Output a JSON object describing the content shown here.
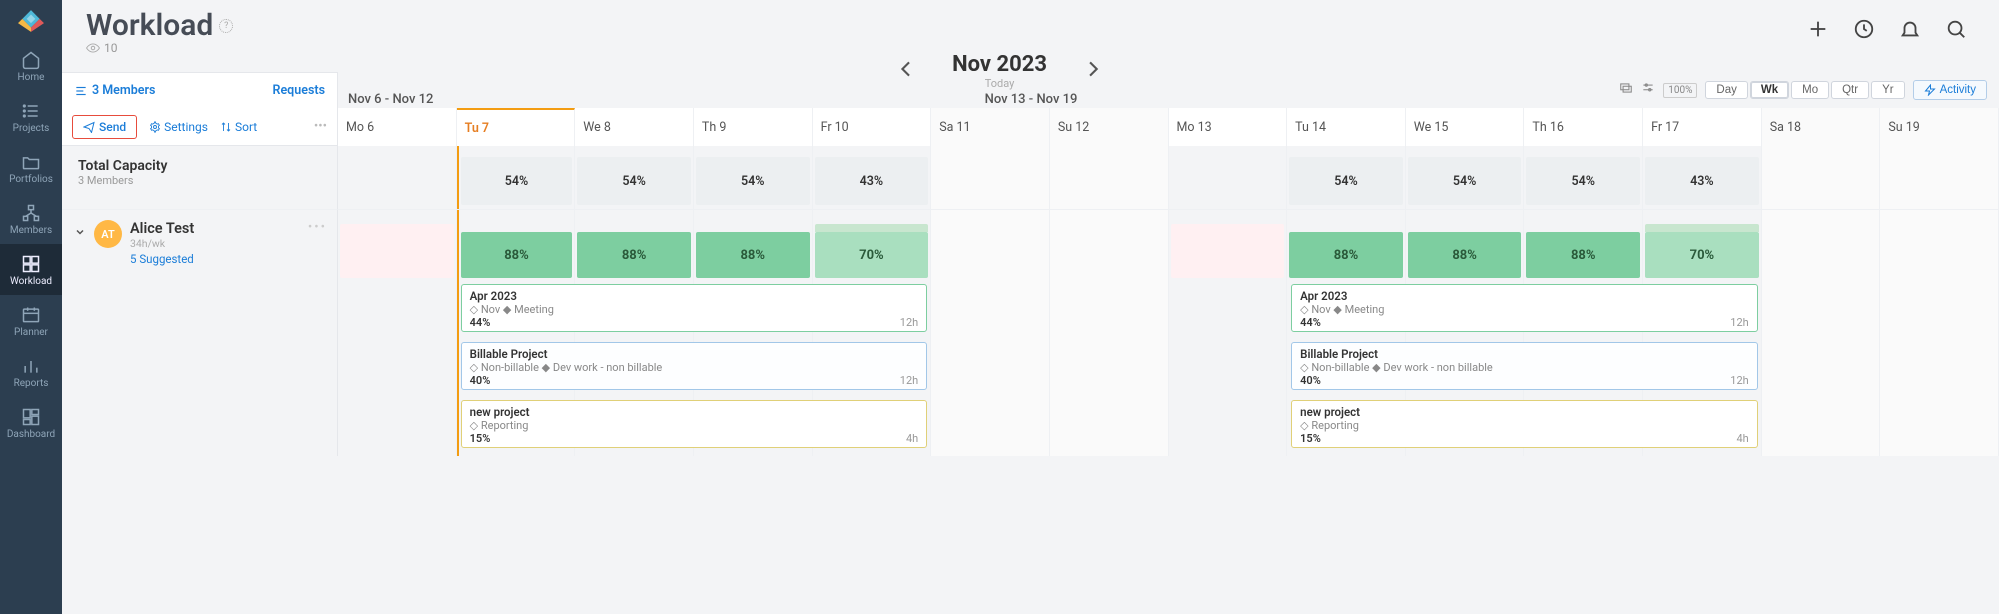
{
  "sidebar": {
    "items": [
      {
        "label": "Home",
        "icon": "home"
      },
      {
        "label": "Projects",
        "icon": "list"
      },
      {
        "label": "Portfolios",
        "icon": "folder"
      },
      {
        "label": "Members",
        "icon": "hierarchy"
      },
      {
        "label": "Workload",
        "icon": "grid",
        "active": true
      },
      {
        "label": "Planner",
        "icon": "planner"
      },
      {
        "label": "Reports",
        "icon": "bars"
      },
      {
        "label": "Dashboard",
        "icon": "dashboard"
      }
    ]
  },
  "header": {
    "title": "Workload",
    "help": "?",
    "views_count": "10",
    "date_title": "Nov 2023",
    "date_subtitle": "Today"
  },
  "toolbar": {
    "members_link": "3 Members",
    "requests_link": "Requests",
    "period1": "Nov 6 - Nov 12",
    "period2": "Nov 13 - Nov 19",
    "zoom_levels": [
      "Day",
      "Wk",
      "Mo",
      "Qtr",
      "Yr"
    ],
    "zoom_active": "Wk",
    "zoom_pct": "100%",
    "activity_btn": "Activity"
  },
  "actions": {
    "send": "Send",
    "settings": "Settings",
    "sort": "Sort",
    "more": "•••"
  },
  "days": [
    {
      "label": "Mo 6",
      "weekend": false
    },
    {
      "label": "Tu 7",
      "weekend": false,
      "today": true
    },
    {
      "label": "We 8",
      "weekend": false
    },
    {
      "label": "Th 9",
      "weekend": false
    },
    {
      "label": "Fr 10",
      "weekend": false
    },
    {
      "label": "Sa 11",
      "weekend": true
    },
    {
      "label": "Su 12",
      "weekend": true
    },
    {
      "label": "Mo 13",
      "weekend": false
    },
    {
      "label": "Tu 14",
      "weekend": false
    },
    {
      "label": "We 15",
      "weekend": false
    },
    {
      "label": "Th 16",
      "weekend": false
    },
    {
      "label": "Fr 17",
      "weekend": false
    },
    {
      "label": "Sa 18",
      "weekend": true
    },
    {
      "label": "Su 19",
      "weekend": true
    }
  ],
  "capacity": {
    "title": "Total Capacity",
    "subtitle": "3 Members",
    "days": [
      null,
      "54%",
      "54%",
      "54%",
      "43%",
      null,
      null,
      null,
      "54%",
      "54%",
      "54%",
      "43%",
      null,
      null
    ]
  },
  "member": {
    "initials": "AT",
    "name": "Alice Test",
    "hours": "34h/wk",
    "suggested": "5 Suggested",
    "more": "•••",
    "days": [
      {
        "pink": true
      },
      {
        "util": "88%"
      },
      {
        "util": "88%"
      },
      {
        "util": "88%"
      },
      {
        "util": "70%",
        "lighter": true,
        "hint": true
      },
      {},
      {},
      {
        "pink": true
      },
      {
        "util": "88%"
      },
      {
        "util": "88%"
      },
      {
        "util": "88%"
      },
      {
        "util": "70%",
        "lighter": true,
        "hint": true
      },
      {},
      {}
    ]
  },
  "tasks": [
    {
      "title": "Apr 2023",
      "meta": "◇ Nov ◆ Meeting",
      "pct": "44%",
      "hours": "12h",
      "color": "green"
    },
    {
      "title": "Billable Project",
      "meta": "◇ Non-billable ◆ Dev work - non billable",
      "pct": "40%",
      "hours": "12h",
      "color": "blue"
    },
    {
      "title": "new project",
      "meta": "◇ Reporting",
      "pct": "15%",
      "hours": "4h",
      "color": "yellow"
    }
  ]
}
